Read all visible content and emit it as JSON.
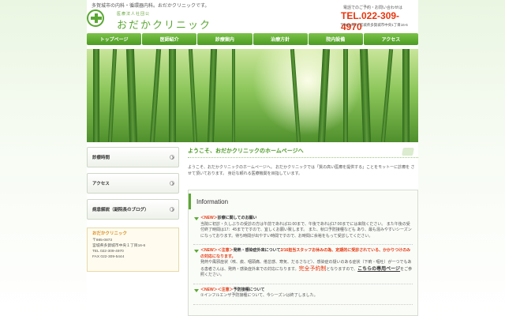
{
  "header": {
    "tagline": "多賀城市の内科・循環器内科。おだかクリニックです。",
    "logo_sub": "医療法人社団公",
    "logo_name": "おだかクリニック",
    "contact_lead": "電話でのご予約・お問い合わせは",
    "tel": "TEL.022-309-4970",
    "address": "〒985-0873 宮城県多賀城市中央1丁目16-6"
  },
  "nav": [
    "トップページ",
    "医師紹介",
    "診療案内",
    "治療方針",
    "院内設備",
    "アクセス"
  ],
  "sidebar": {
    "items": [
      "診療時間",
      "アクセス",
      "病患解説（副院長のブログ）"
    ],
    "info": {
      "name": "おだかクリニック",
      "lines": [
        "〒985-0873",
        "宮城県多賀城市中央１丁目16-6",
        "TEL 022-309-4970",
        "FAX 022-309-5444"
      ]
    }
  },
  "main": {
    "welcome_title": "ようこそ、おだかクリニックのホームページへ",
    "intro": "ようこそ、おだかクリニックのホームページへ。 おだかクリニックでは「質の高い医療を提供する」ことをモットーに診療を させて頂いております。 身近な頼れる医療機関を目指しています。",
    "info_title": "Information",
    "news": [
      {
        "tag": "＜NEW＞",
        "head": "診療に関してのお願い",
        "body": "当院に初診・久しぶりの受診の方は午前であれば11:00まで、午後であれば17:00までには来院ください。 また午後の受付終了時間は17：45までですので、宜しくお願い致します。 また、秋口予防接種なども あり、最も混みやすいシーズンになっております。待ち時間が出やすい時間ですので、お時間に余裕をもって受診してください。"
      },
      {
        "tag": "＜NEW＞＜注意＞",
        "head": "発熱・感染症外来について",
        "red": "2/16担当スタッフお休みの為、定期的に受診されている、かかりつけのみの対応になります。",
        "body": "発熱や風邪症状（咳、痰、咽頭痛、倦怠感、寒気、だるさなど）、感染症の疑いのある症状（下痢・嘔吐）が一つでもある患者さんは、発熱・感染症外来での対応になります。",
        "big": "完全予約制",
        "tail": "となりますので、",
        "link": "こちらの専用ページ",
        "tail2": "をご参照ください。"
      },
      {
        "tag": "＜NEW＞＜注意＞",
        "head": "予防接種について",
        "body": "①インフルエンザ予防接種について、今シーズンは終了しました。"
      }
    ]
  },
  "colors": {
    "brand_green": "#5aa832",
    "tel_red": "#e7360e",
    "accent_orange": "#d98a1c"
  }
}
